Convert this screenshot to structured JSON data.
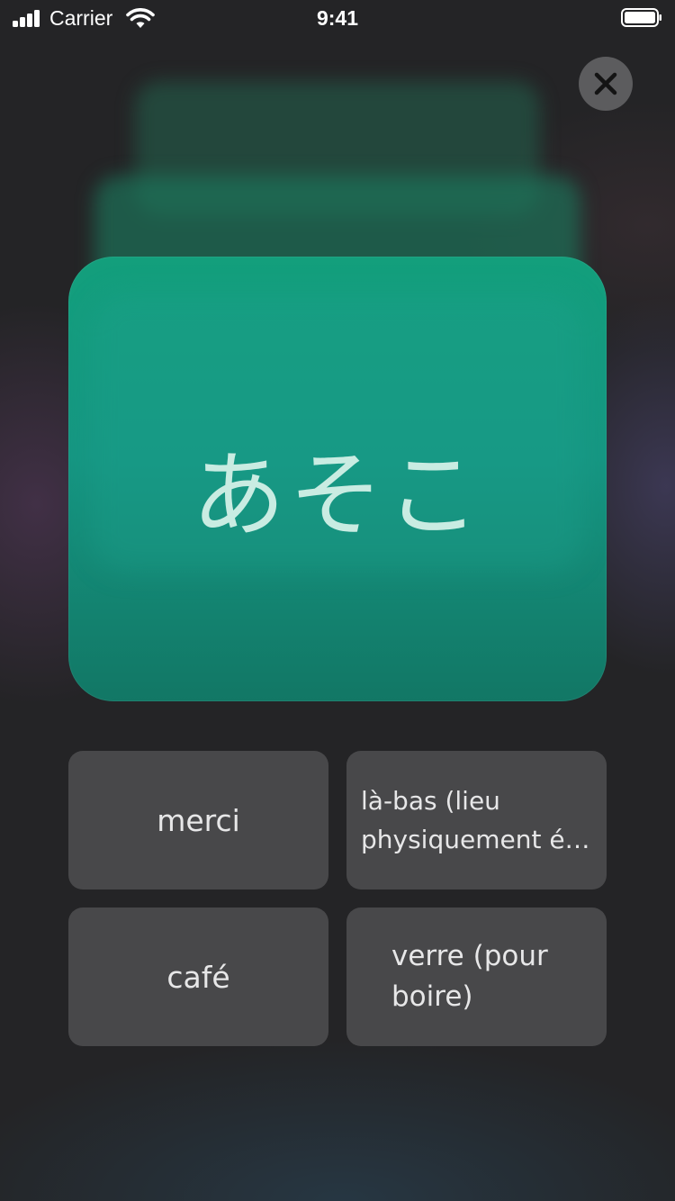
{
  "status_bar": {
    "carrier": "Carrier",
    "time": "9:41"
  },
  "flashcard": {
    "word": "あそこ",
    "color": "#139f7c"
  },
  "answers": [
    {
      "label_line1": "merci",
      "label_line2": ""
    },
    {
      "label_line1": "là-bas (lieu",
      "label_line2": "physiquement é…"
    },
    {
      "label_line1": "café",
      "label_line2": ""
    },
    {
      "label_line1": "verre (pour",
      "label_line2": "boire)"
    }
  ],
  "icons": {
    "close": "close-icon",
    "signal": "cellular-signal-icon",
    "wifi": "wifi-icon",
    "battery": "battery-icon"
  }
}
